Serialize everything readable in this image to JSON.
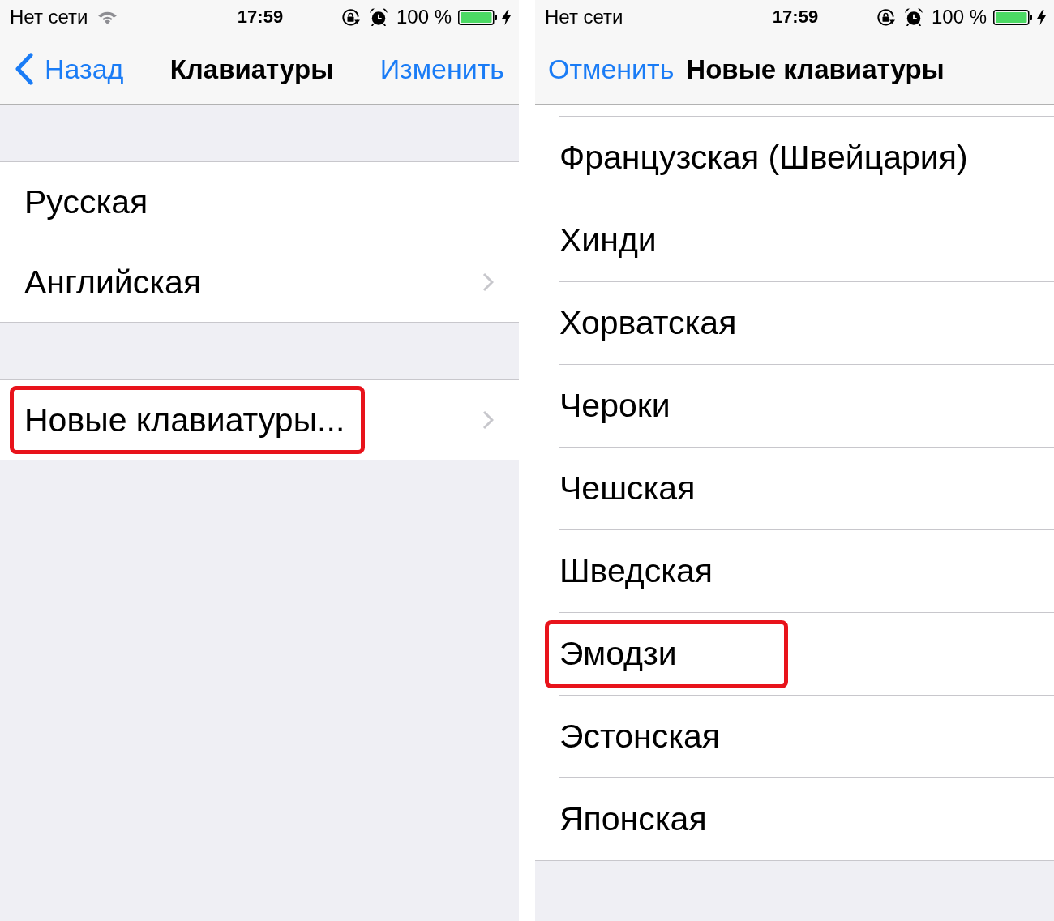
{
  "screens": [
    {
      "status_bar": {
        "carrier": "Нет сети",
        "wifi": true,
        "time": "17:59",
        "rotation_lock": true,
        "alarm": true,
        "battery_text": "100 %",
        "charging": true
      },
      "nav_bar": {
        "left_button": {
          "label": "Назад",
          "chevron": true
        },
        "title": "Клавиатуры",
        "right_button": {
          "label": "Изменить"
        }
      },
      "groups": [
        {
          "cut_off_above": false,
          "rows": [
            {
              "label": "Русская",
              "chevron": false,
              "highlighted": false
            },
            {
              "label": "Английская",
              "chevron": true,
              "highlighted": false
            }
          ]
        },
        {
          "cut_off_above": false,
          "rows": [
            {
              "label": "Новые клавиатуры...",
              "chevron": true,
              "highlighted": true
            }
          ]
        }
      ]
    },
    {
      "status_bar": {
        "carrier": "Нет сети",
        "wifi": false,
        "time": "17:59",
        "rotation_lock": true,
        "alarm": true,
        "battery_text": "100 %",
        "charging": true
      },
      "nav_bar": {
        "left_button": {
          "label": "Отменить",
          "chevron": false
        },
        "title": "Новые клавиатуры"
      },
      "groups": [
        {
          "cut_off_above": true,
          "rows": [
            {
              "label": "Французская (Швейцария)",
              "chevron": false,
              "highlighted": false
            },
            {
              "label": "Хинди",
              "chevron": false,
              "highlighted": false
            },
            {
              "label": "Хорватская",
              "chevron": false,
              "highlighted": false
            },
            {
              "label": "Чероки",
              "chevron": false,
              "highlighted": false
            },
            {
              "label": "Чешская",
              "chevron": false,
              "highlighted": false
            },
            {
              "label": "Шведская",
              "chevron": false,
              "highlighted": false
            },
            {
              "label": "Эмодзи",
              "chevron": false,
              "highlighted": true
            },
            {
              "label": "Эстонская",
              "chevron": false,
              "highlighted": false
            },
            {
              "label": "Японская",
              "chevron": false,
              "highlighted": false
            }
          ]
        }
      ]
    }
  ]
}
